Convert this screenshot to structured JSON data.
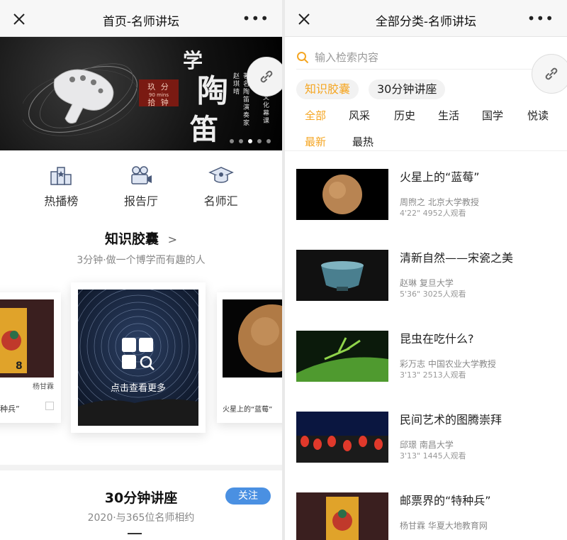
{
  "left": {
    "nav": {
      "title": "首页-名师讲坛"
    },
    "banner": {
      "box_line1": "玖 分",
      "box_line2": "拾 钟",
      "box_small": "90 mins",
      "char1": "学",
      "char2": "陶",
      "char3": "笛",
      "vertical_name": "赵琪晴",
      "vertical_role": "著名陶笛演奏家",
      "vertical_tag": "文化幕课"
    },
    "quick": [
      {
        "label": "热播榜",
        "icon": "hot-list-icon"
      },
      {
        "label": "报告厅",
        "icon": "lecture-hall-icon"
      },
      {
        "label": "名师汇",
        "icon": "graduation-cap-icon"
      }
    ],
    "capsule": {
      "title": "知识胶囊",
      "arrow": ">",
      "subtitle": "3分钟·做一个博学而有趣的人",
      "center_label": "点击查看更多",
      "left_card_author": "杨甘霖",
      "left_card_caption": "种兵”",
      "right_card_caption": "火星上的“蓝莓”"
    },
    "lecture": {
      "title": "30分钟讲座",
      "subtitle": "2020·与365位名师相约",
      "follow": "关注"
    }
  },
  "right": {
    "nav": {
      "title": "全部分类-名师讲坛"
    },
    "search": {
      "placeholder": "输入检索内容"
    },
    "pills": [
      "知识胶囊",
      "30分钟讲座"
    ],
    "categories": [
      "全部",
      "风采",
      "历史",
      "生活",
      "国学",
      "悦读"
    ],
    "sorts": [
      "最新",
      "最热"
    ],
    "items": [
      {
        "title": "火星上的“蓝莓”",
        "author": "周煦之 北京大学教授",
        "meta": "4'22\"  4952人观看"
      },
      {
        "title": "清新自然——宋瓷之美",
        "author": "赵琳 复旦大学",
        "meta": "5'36\"  3025人观看"
      },
      {
        "title": "昆虫在吃什么?",
        "author": "彩万志 中国农业大学教授",
        "meta": "3'13\"  2513人观看"
      },
      {
        "title": "民间艺术的图腾崇拜",
        "author": "邱璟 南昌大学",
        "meta": "3'13\"  1445人观看"
      },
      {
        "title": "邮票界的“特种兵”",
        "author": "杨甘霖 华夏大地教育网",
        "meta": ""
      }
    ]
  },
  "colors": {
    "accent": "#f5a623",
    "follow": "#4a90e2"
  }
}
